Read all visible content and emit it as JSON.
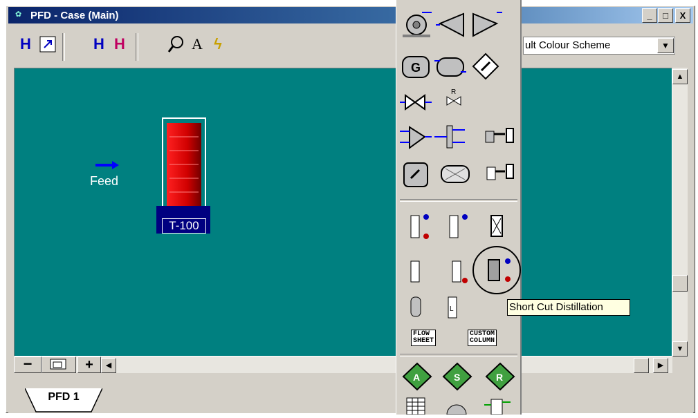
{
  "window": {
    "title": "PFD - Case (Main)",
    "minimize_label": "_",
    "maximize_label": "□",
    "close_label": "X"
  },
  "toolbar": {
    "scheme_value": "ult Colour Scheme",
    "text_tool_label": "A"
  },
  "canvas": {
    "feed_label": "Feed",
    "column_label": "T-100",
    "background_color": "#008080"
  },
  "zoom": {
    "minus_label": "−",
    "plus_label": "+"
  },
  "tabs": [
    {
      "label": "PFD 1"
    }
  ],
  "palette": {
    "gen_label": "G",
    "valve_label": "R",
    "flowsheet_label": "FLOW\nSHEET",
    "custom_column_label": "CUSTOM\nCOLUMN",
    "logic_a": "A",
    "logic_s": "S",
    "logic_r": "R",
    "tooltip": "Short Cut Distillation"
  }
}
